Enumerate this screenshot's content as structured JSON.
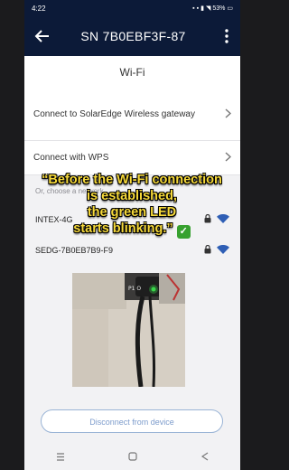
{
  "status_bar": {
    "time": "4:22",
    "battery": "53%"
  },
  "app_bar": {
    "title": "SN 7B0EBF3F-87"
  },
  "section": {
    "title": "Wi-Fi"
  },
  "menu": {
    "connect_gateway": "Connect to SolarEdge Wireless gateway",
    "connect_wps": "Connect with WPS"
  },
  "networks": {
    "label": "Or, choose a network",
    "items": [
      {
        "name": "INTEX-4G"
      },
      {
        "name": "SEDG-7B0EB7B9-F9"
      }
    ]
  },
  "photo": {
    "led_label": "P1 O"
  },
  "disconnect_button": "Disconnect from device",
  "caption": {
    "line1": "“Before the Wi-Fi connection",
    "line2": "is established,",
    "line3": "the green LED",
    "line4": "starts blinking.”",
    "check": "✓"
  },
  "colors": {
    "app_bar": "#0c1a38",
    "caption_text": "#f6d93a",
    "accent": "#2f5fb5",
    "led": "#39d64a"
  }
}
